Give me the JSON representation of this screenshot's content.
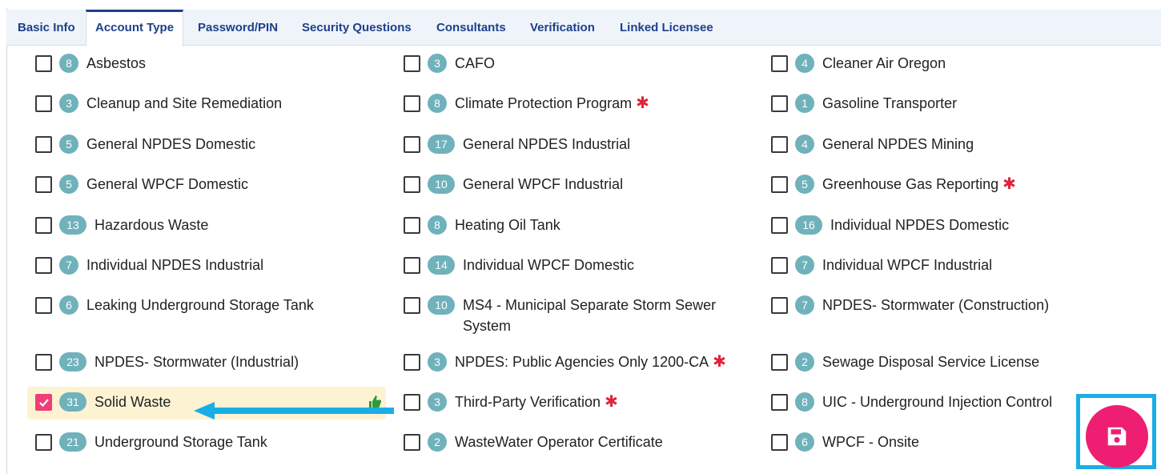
{
  "tabs": [
    {
      "label": "Basic Info"
    },
    {
      "label": "Account Type"
    },
    {
      "label": "Password/PIN"
    },
    {
      "label": "Security Questions"
    },
    {
      "label": "Consultants"
    },
    {
      "label": "Verification"
    },
    {
      "label": "Linked Licensee"
    }
  ],
  "active_tab": "Account Type",
  "account_types": {
    "col1": [
      {
        "count": "8",
        "label": "Asbestos",
        "checked": false,
        "required": false
      },
      {
        "count": "3",
        "label": "Cleanup and Site Remediation",
        "checked": false,
        "required": false
      },
      {
        "count": "5",
        "label": "General NPDES Domestic",
        "checked": false,
        "required": false
      },
      {
        "count": "5",
        "label": "General WPCF Domestic",
        "checked": false,
        "required": false
      },
      {
        "count": "13",
        "label": "Hazardous Waste",
        "checked": false,
        "required": false
      },
      {
        "count": "7",
        "label": "Individual NPDES Industrial",
        "checked": false,
        "required": false
      },
      {
        "count": "6",
        "label": "Leaking Underground Storage Tank",
        "checked": false,
        "required": false
      },
      {
        "count": "23",
        "label": "NPDES- Stormwater (Industrial)",
        "checked": false,
        "required": false
      },
      {
        "count": "31",
        "label": "Solid Waste",
        "checked": true,
        "required": false
      },
      {
        "count": "21",
        "label": "Underground Storage Tank",
        "checked": false,
        "required": false
      }
    ],
    "col2": [
      {
        "count": "3",
        "label": "CAFO",
        "checked": false,
        "required": false
      },
      {
        "count": "8",
        "label": "Climate Protection Program",
        "checked": false,
        "required": true
      },
      {
        "count": "17",
        "label": "General NPDES Industrial",
        "checked": false,
        "required": false
      },
      {
        "count": "10",
        "label": "General WPCF Industrial",
        "checked": false,
        "required": false
      },
      {
        "count": "8",
        "label": "Heating Oil Tank",
        "checked": false,
        "required": false
      },
      {
        "count": "14",
        "label": "Individual WPCF Domestic",
        "checked": false,
        "required": false
      },
      {
        "count": "10",
        "label": "MS4 - Municipal Separate Storm Sewer System",
        "checked": false,
        "required": false
      },
      {
        "count": "3",
        "label": "NPDES: Public Agencies Only 1200-CA",
        "checked": false,
        "required": true
      },
      {
        "count": "3",
        "label": "Third-Party Verification",
        "checked": false,
        "required": true
      },
      {
        "count": "2",
        "label": "WasteWater Operator Certificate",
        "checked": false,
        "required": false
      }
    ],
    "col3": [
      {
        "count": "4",
        "label": "Cleaner Air Oregon",
        "checked": false,
        "required": false
      },
      {
        "count": "1",
        "label": "Gasoline Transporter",
        "checked": false,
        "required": false
      },
      {
        "count": "4",
        "label": "General NPDES Mining",
        "checked": false,
        "required": false
      },
      {
        "count": "5",
        "label": "Greenhouse Gas Reporting",
        "checked": false,
        "required": true
      },
      {
        "count": "16",
        "label": "Individual NPDES Domestic",
        "checked": false,
        "required": false
      },
      {
        "count": "7",
        "label": "Individual WPCF Industrial",
        "checked": false,
        "required": false
      },
      {
        "count": "7",
        "label": "NPDES- Stormwater (Construction)",
        "checked": false,
        "required": false
      },
      {
        "count": "2",
        "label": "Sewage Disposal Service License",
        "checked": false,
        "required": false
      },
      {
        "count": "8",
        "label": "UIC - Underground Injection Control",
        "checked": false,
        "required": false
      },
      {
        "count": "6",
        "label": "WPCF - Onsite",
        "checked": false,
        "required": false
      }
    ]
  },
  "required_marker": "✱",
  "colors": {
    "tab_text": "#1e3f8a",
    "badge": "#6fb2bb",
    "checked": "#ee3d78",
    "save_button": "#ee1e72",
    "highlight": "#1aaee7",
    "arrow": "#1aaee7",
    "required": "#e0243a"
  },
  "icons": {
    "save": "floppy-disk-icon",
    "check": "checkmark-icon",
    "arrow": "arrow-left-icon",
    "thumb": "thumbs-up-icon"
  }
}
